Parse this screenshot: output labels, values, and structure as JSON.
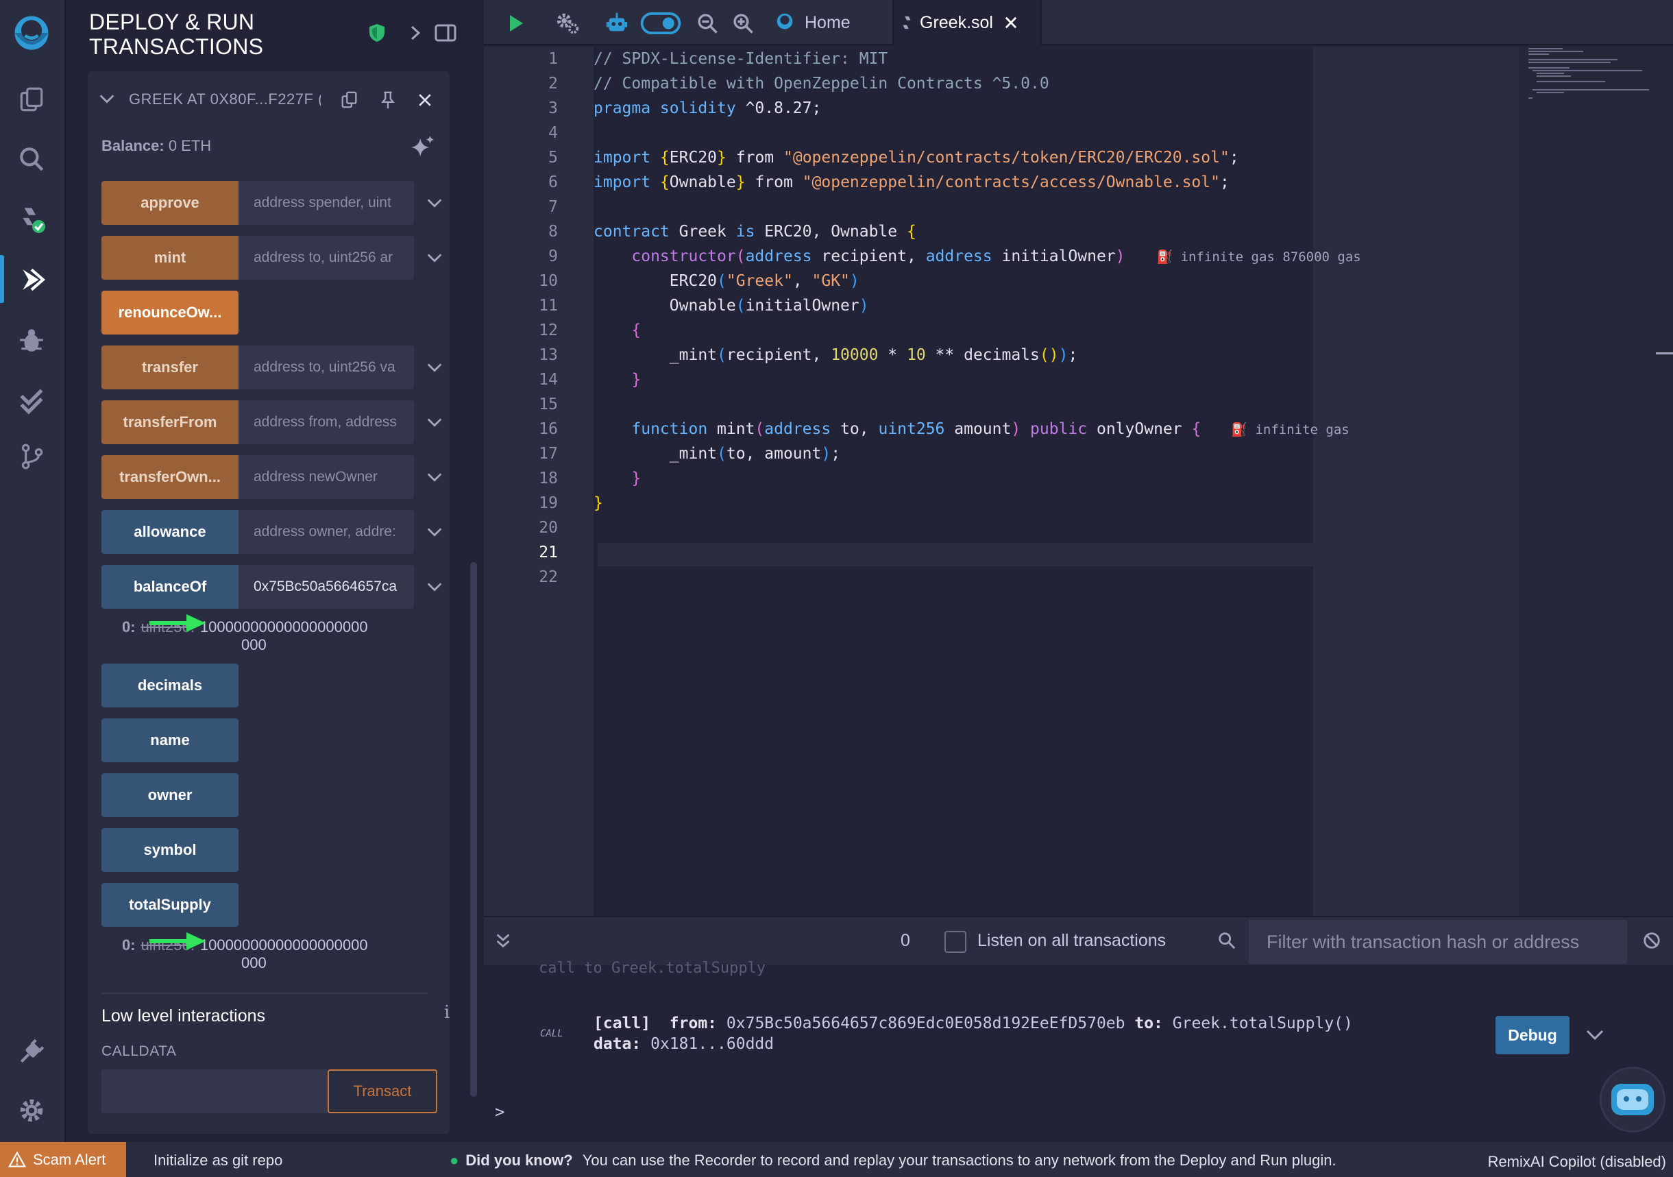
{
  "panel": {
    "title": "DEPLOY & RUN\nTRANSACTIONS",
    "instance_label": "GREEK AT 0X80F...F227F (I",
    "balance_label": "Balance:",
    "balance_value": " 0 ETH",
    "functions": [
      {
        "name": "approve",
        "placeholder": "address spender, uint",
        "kind": "nonpay"
      },
      {
        "name": "mint",
        "placeholder": "address to, uint256 ar",
        "kind": "nonpay"
      },
      {
        "name": "renounceOw...",
        "placeholder": "",
        "kind": "pay"
      },
      {
        "name": "transfer",
        "placeholder": "address to, uint256 va",
        "kind": "nonpay"
      },
      {
        "name": "transferFrom",
        "placeholder": "address from, address",
        "kind": "nonpay"
      },
      {
        "name": "transferOwn...",
        "placeholder": "address newOwner",
        "kind": "nonpay"
      },
      {
        "name": "allowance",
        "placeholder": "address owner, addre:",
        "kind": "view"
      },
      {
        "name": "balanceOf",
        "value": "0x75Bc50a5664657ca",
        "kind": "view"
      },
      {
        "name": "decimals",
        "kind": "view"
      },
      {
        "name": "name",
        "kind": "view"
      },
      {
        "name": "owner",
        "kind": "view"
      },
      {
        "name": "symbol",
        "kind": "view"
      },
      {
        "name": "totalSupply",
        "kind": "view"
      }
    ],
    "balance_result": {
      "index": "0:",
      "type": "uint256:",
      "value_line1": "10000000000000000000",
      "value_line2": "000"
    },
    "supply_result": {
      "index": "0:",
      "type": "uint256:",
      "value_line1": "10000000000000000000",
      "value_line2": "000"
    },
    "low_level_title": "Low level interactions",
    "calldata_label": "CALLDATA",
    "transact_label": "Transact"
  },
  "tabs": {
    "home_label": "Home",
    "file_label": "Greek.sol"
  },
  "editor": {
    "line_numbers": [
      "1",
      "2",
      "3",
      "4",
      "5",
      "6",
      "7",
      "8",
      "9",
      "10",
      "11",
      "12",
      "13",
      "14",
      "15",
      "16",
      "17",
      "18",
      "19",
      "20",
      "21",
      "22"
    ],
    "current_line": "21",
    "code": {
      "l1": "// SPDX-License-Identifier: MIT",
      "l2": "// Compatible with OpenZeppelin Contracts ^5.0.0",
      "l3a": "pragma solidity",
      "l3b": " ^0.8.27;",
      "l5a": "import",
      "l5b": " {",
      "l5c": "ERC20",
      "l5d": "}",
      "l5e": " from ",
      "l5f": "\"@openzeppelin/contracts/token/ERC20/ERC20.sol\"",
      "l5g": ";",
      "l6a": "import",
      "l6b": " {",
      "l6c": "Ownable",
      "l6d": "}",
      "l6e": " from ",
      "l6f": "\"@openzeppelin/contracts/access/Ownable.sol\"",
      "l6g": ";",
      "l8a": "contract",
      "l8b": " Greek ",
      "l8c": "is",
      "l8d": " ERC20, Ownable ",
      "l8e": "{",
      "l9a": "    constructor",
      "l9b": "(",
      "l9c": "address",
      "l9d": " recipient, ",
      "l9e": "address",
      "l9f": " initialOwner",
      "l9g": ")",
      "l9gas": "infinite gas 876000 gas",
      "l10a": "        ERC20",
      "l10b": "(",
      "l10c": "\"Greek\"",
      "l10d": ", ",
      "l10e": "\"GK\"",
      "l10f": ")",
      "l11a": "        Ownable",
      "l11b": "(",
      "l11c": "initialOwner",
      "l11d": ")",
      "l12": "    {",
      "l13a": "        _mint",
      "l13b": "(",
      "l13c": "recipient, ",
      "l13d": "10000",
      "l13e": " * ",
      "l13f": "10",
      "l13g": " ** decimals",
      "l13h": "()",
      "l13i": ")",
      "l13j": ";",
      "l14": "    }",
      "l16a": "    function",
      "l16b": " mint",
      "l16c": "(",
      "l16d": "address",
      "l16e": " to, ",
      "l16f": "uint256",
      "l16g": " amount",
      "l16h": ")",
      "l16i": " public",
      "l16j": " onlyOwner ",
      "l16k": "{",
      "l16gas": "infinite gas",
      "l17a": "        _mint",
      "l17b": "(",
      "l17c": "to, amount",
      "l17d": ")",
      "l17e": ";",
      "l18": "    }",
      "l19": "}"
    }
  },
  "terminal": {
    "count": "0",
    "listen_label": "Listen on all transactions",
    "filter_placeholder": "Filter with transaction hash or address",
    "ghost_text": "call to Greek.totalSupply",
    "call_tag": "CALL",
    "tx_call": "[call]",
    "tx_from_label": "from:",
    "tx_from": "0x75Bc50a5664657c869Edc0E058d192EeEfD570eb",
    "tx_to_label": "to:",
    "tx_to": "Greek.totalSupply()",
    "tx_data_label": "data:",
    "tx_data": "0x181...60ddd",
    "debug_label": "Debug",
    "prompt": ">"
  },
  "status": {
    "scam_label": "Scam Alert",
    "git_label": "Initialize as git repo",
    "tip_title": "Did you know?",
    "tip_text": "You can use the Recorder to record and replay your transactions to any network from the Deploy and Run plugin.",
    "copilot_label": "RemixAI Copilot (disabled)"
  },
  "colors": {
    "accent": "#2f9bd6",
    "nonpayable": "#9a6138",
    "payable": "#c97539",
    "view": "#365576"
  }
}
